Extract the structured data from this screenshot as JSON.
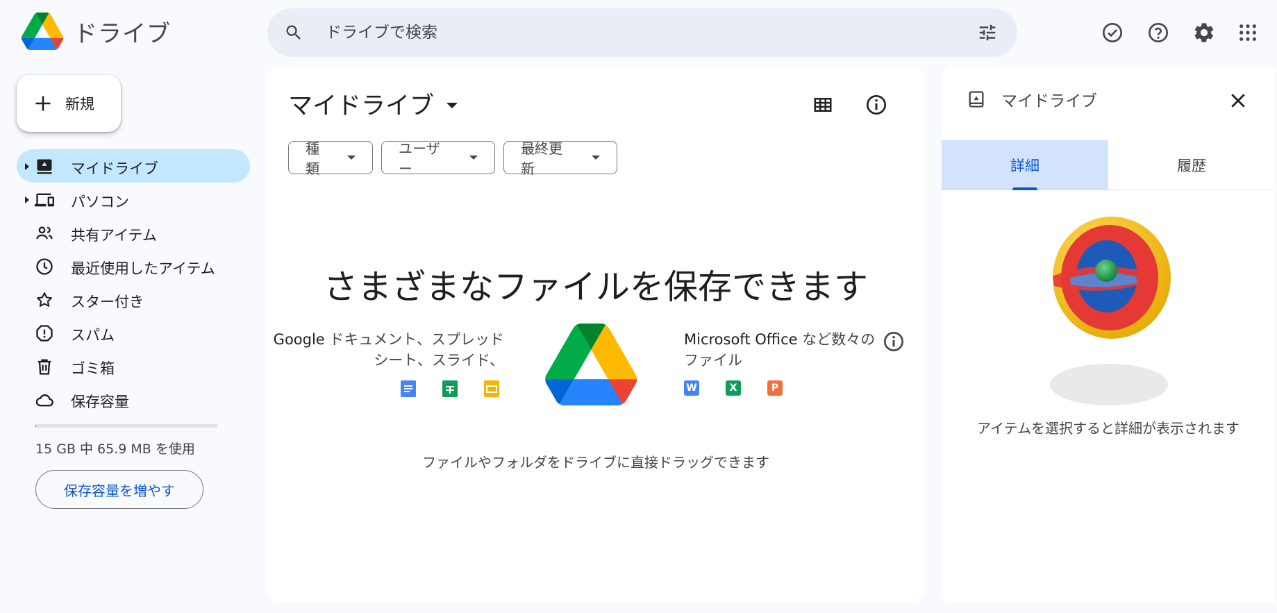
{
  "header": {
    "app_name": "ドライブ",
    "search_placeholder": "ドライブで検索"
  },
  "sidebar": {
    "new_label": "新規",
    "items": [
      {
        "label": "マイドライブ",
        "active": true
      },
      {
        "label": "パソコン"
      },
      {
        "label": "共有アイテム"
      },
      {
        "label": "最近使用したアイテム"
      },
      {
        "label": "スター付き"
      },
      {
        "label": "スパム"
      },
      {
        "label": "ゴミ箱"
      },
      {
        "label": "保存容量"
      }
    ],
    "storage": {
      "used_fraction": 0.0044,
      "text": "15 GB 中 65.9 MB を使用",
      "button": "保存容量を増やす"
    }
  },
  "main": {
    "title": "マイドライブ",
    "filters": [
      "種類",
      "ユーザー",
      "最終更新"
    ],
    "empty": {
      "headline": "さまざまなファイルを保存できます",
      "left_brand": "Google",
      "left_text_1": " ドキュメント、スプレッド",
      "left_text_2": "シート、スライド、",
      "right_brand": "Microsoft Office",
      "right_text_1": " など数々の",
      "right_text_2": "ファイル",
      "drag_hint": "ファイルやフォルダをドライブに直接ドラッグできます",
      "office_letters": [
        "W",
        "X",
        "P"
      ]
    }
  },
  "details": {
    "title": "マイドライブ",
    "tabs": [
      "詳細",
      "履歴"
    ],
    "hint": "アイテムを選択すると詳細が表示されます"
  },
  "colors": {
    "accent": "#0b57d0",
    "active_nav": "#c2e7ff",
    "word": "#4285f4",
    "excel": "#0f9d58",
    "ppt": "#f4703a"
  }
}
